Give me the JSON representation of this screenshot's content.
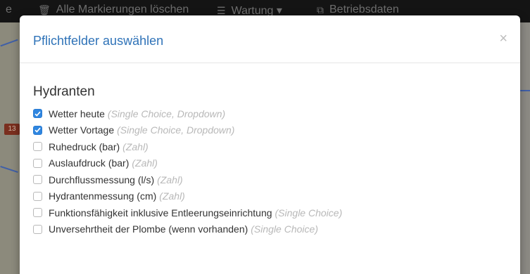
{
  "navbar": {
    "left_fragment": "e",
    "items": [
      {
        "icon": "trash-icon",
        "glyph": "🗑",
        "label": "Alle Markierungen löschen"
      },
      {
        "icon": "list-icon",
        "glyph": "☰",
        "label": "Wartung ▾"
      },
      {
        "icon": "copy-icon",
        "glyph": "⧉",
        "label": "Betriebsdaten"
      }
    ]
  },
  "map": {
    "badge": "13"
  },
  "modal": {
    "title": "Pflichtfelder auswählen",
    "close_label": "×",
    "section_title": "Hydranten",
    "fields": [
      {
        "label": "Wetter heute",
        "type": "(Single Choice, Dropdown)",
        "checked": true
      },
      {
        "label": "Wetter Vortage",
        "type": "(Single Choice, Dropdown)",
        "checked": true
      },
      {
        "label": "Ruhedruck (bar)",
        "type": "(Zahl)",
        "checked": false
      },
      {
        "label": "Auslaufdruck (bar)",
        "type": "(Zahl)",
        "checked": false
      },
      {
        "label": "Durchflussmessung (l/s)",
        "type": "(Zahl)",
        "checked": false
      },
      {
        "label": "Hydrantenmessung (cm)",
        "type": "(Zahl)",
        "checked": false
      },
      {
        "label": "Funktionsfähigkeit inklusive Entleerungseinrichtung",
        "type": "(Single Choice)",
        "checked": false
      },
      {
        "label": "Unversehrtheit der Plombe (wenn vorhanden)",
        "type": "(Single Choice)",
        "checked": false
      }
    ]
  },
  "colors": {
    "accent": "#2f73b8",
    "checkbox_checked": "#2f86e0",
    "type_hint": "#b8b8b8"
  }
}
